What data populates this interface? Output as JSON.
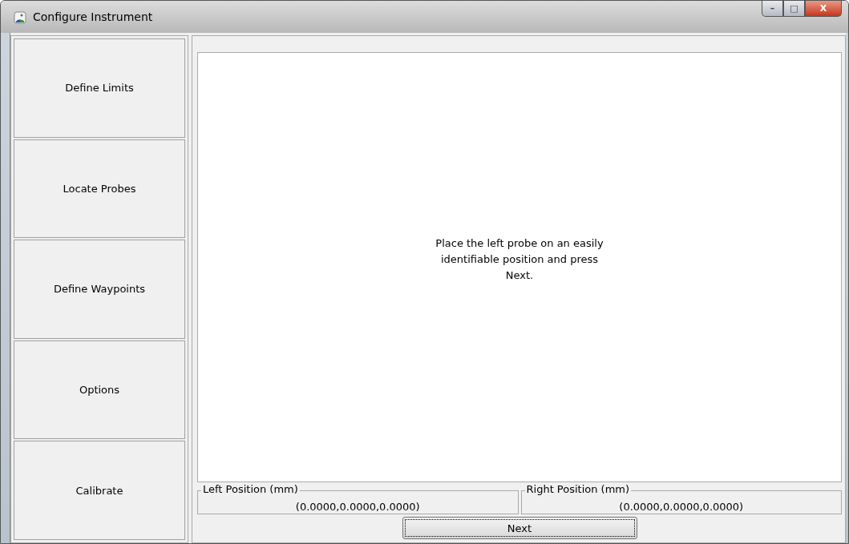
{
  "window": {
    "title": "Configure Instrument",
    "controls": {
      "minimize": "–",
      "maximize": "□",
      "close": "X"
    }
  },
  "sidebar": {
    "items": [
      {
        "label": "Define Limits"
      },
      {
        "label": "Locate Probes"
      },
      {
        "label": "Define Waypoints"
      },
      {
        "label": "Options"
      },
      {
        "label": "Calibrate"
      }
    ]
  },
  "instructions": "Place the left probe on an easily identifiable position and press Next.",
  "positions": [
    {
      "label": "Left Position (mm)",
      "value": "(0.0000,0.0000,0.0000)"
    },
    {
      "label": "Right Position (mm)",
      "value": "(0.0000,0.0000,0.0000)"
    }
  ],
  "next_button": "Next"
}
